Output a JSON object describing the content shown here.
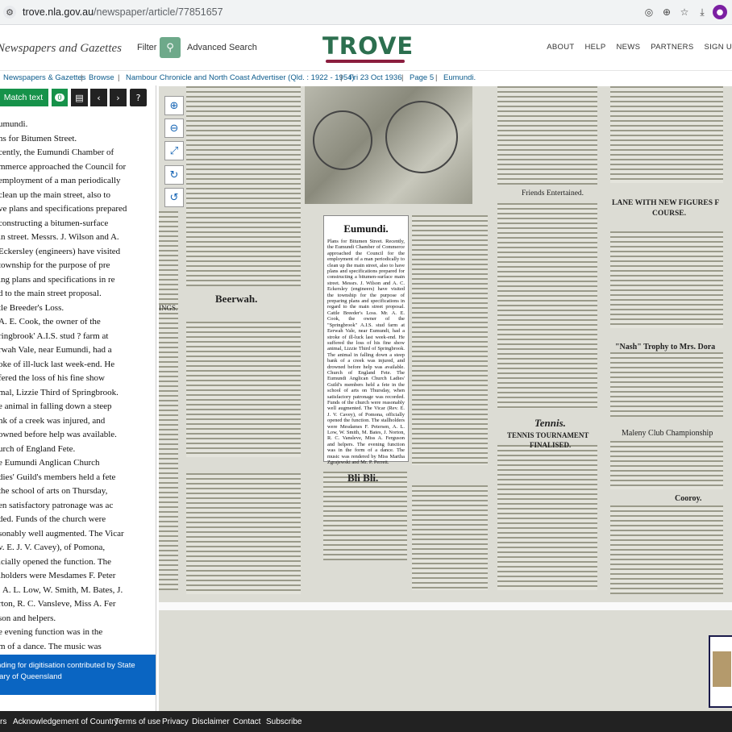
{
  "browser": {
    "url_host": "trove.nla.gov.au",
    "url_path": "/newspaper/article/77851657"
  },
  "header": {
    "brand": "Newspapers and Gazettes",
    "filter_label": "Filter",
    "advanced_search": "Advanced Search",
    "logo": "TROVE",
    "nav": [
      "ABOUT",
      "HELP",
      "NEWS",
      "PARTNERS",
      "SIGN U"
    ]
  },
  "breadcrumbs": [
    "Newspapers & Gazettes",
    "Browse",
    "Nambour Chronicle and North Coast Advertiser (Qld. : 1922 - 1954)",
    "Fri 23 Oct 1936",
    "Page 5",
    "Eumundi."
  ],
  "toolbar": {
    "match_text": "Match text",
    "count": "0"
  },
  "ocr_lines": [
    "umundi.",
    "ns for Bitumen Street.",
    "cently, the Eumundi Chamber of",
    "mmerce approached the Council for",
    "employment of a man periodically",
    "clean up the main street, also to",
    "ve plans and specifications prepared",
    "constructing a bitumen-surface",
    "in street. Messrs. J. Wilson and A.",
    "Eckersley (engineers) have visited",
    "township for the purpose of pre",
    "ing plans and specifications in re",
    "d to the main street proposal.",
    "tle Breeder's Loss.",
    "A. E. Cook, the owner of the",
    "ringbrook' A.I.S. stud ? farm at",
    "rwah Vale, near Eumundi, had a",
    "oke of ill-luck last week-end. He",
    "fered the loss of his fine show",
    "mal, Lizzie Third of Springbrook.",
    "e animal in falling down a steep",
    "nk of a creek was injured, and",
    "owned before help was available.",
    "urch of England Fete.",
    "e Eumundi Anglican Church",
    "dies' Guild's members held a fete",
    "the school of arts on Thursday,",
    "en satisfactory patronage was ac",
    "ded. Funds of the church were",
    "sonably well augmented. The Vicar",
    "v. E. J. V. Cavey), of Pomona,",
    "icially opened the function. The",
    "lholders were Mesdames F. Peter",
    ", A. L. Low, W. Smith, M. Bates, J.",
    "rton, R. C. Vansleve, Miss A. Fer",
    "son and helpers.",
    "e evening function was in the",
    "m of a dance. The music was"
  ],
  "funding": [
    "nding for digitisation contributed by State",
    "rary of Queensland"
  ],
  "viewer": {
    "article_title": "Eumundi.",
    "article_body": "Plans for Bitumen Street. Recently, the Eumundi Chamber of Commerce approached the Council for the employment of a man periodically to clean up the main street, also to have plans and specifications prepared for constructing a bitumen-surface main street. Messrs. J. Wilson and A. C. Eckersley (engineers) have visited the township for the purpose of preparing plans and specifications in regard to the main street proposal. Cattle Breeder's Loss. Mr. A. E. Cook, the owner of the \"Springbrook\" A.I.S. stud farm at Eerwah Vale, near Eumundi, had a stroke of ill-luck last week-end. He suffered the loss of his fine show animal, Lizzie Third of Springbrook. The animal in falling down a steep bank of a creek was injured, and drowned before help was available. Church of England Fete. The Eumundi Anglican Church Ladies' Guild's members held a fete in the school of arts on Thursday, when satisfactory patronage was recorded. Funds of the church were reasonably well augmented. The Vicar (Rev. E. J. V. Cavey), of Pomona, officially opened the function. The stallholders were Mesdames F. Petersen, A. L. Low, W. Smith, M. Bates, J. Norton, R. C. Vansleve, Miss A. Ferguson and helpers. The evening function was in the form of a dance. The music was rendered by Miss Martha Zgrajewski and Mr. P. Perrett.",
    "headings": [
      "Beerwah.",
      "Bli Bli.",
      "Friends Entertained.",
      "Tennis.",
      "TENNIS TOURNAMENT",
      "FINALISED.",
      "LANE WITH NEW FIGURES F",
      "COURSE.",
      "\"Nash\" Trophy to Mrs. Dora",
      "Maleny Club Championship",
      "Cooroy.",
      "INGS."
    ]
  },
  "footer": [
    "rs",
    "Acknowledgement of Country",
    "Terms of use",
    "Privacy",
    "Disclaimer",
    "Contact",
    "Subscribe"
  ]
}
